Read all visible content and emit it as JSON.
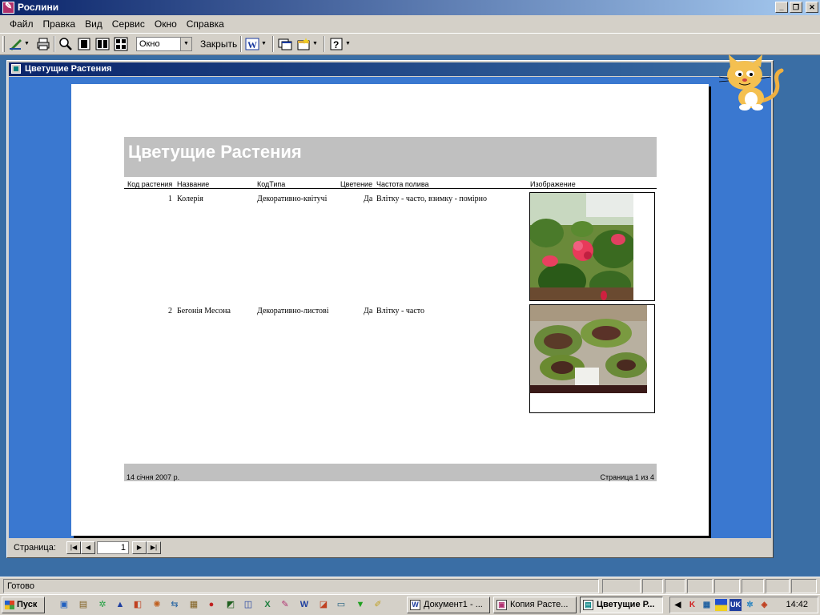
{
  "window": {
    "title": "Рослини"
  },
  "menu": [
    {
      "label": "Файл"
    },
    {
      "label": "Правка"
    },
    {
      "label": "Вид"
    },
    {
      "label": "Сервис"
    },
    {
      "label": "Окно"
    },
    {
      "label": "Справка"
    }
  ],
  "toolbar": {
    "zoom_value": "Окно",
    "close_label": "Закрыть"
  },
  "child": {
    "title": "Цветущие Растения"
  },
  "report": {
    "title": "Цветущие Растения",
    "columns": [
      "Код растения",
      "Название",
      "КодТипа",
      "Цветение",
      "Частота полива",
      "Изображение"
    ],
    "rows": [
      {
        "code": "1",
        "name": "Колерія",
        "type": "Декоративно-квітучі",
        "bloom": "Да",
        "water": "Влітку - часто, взимку - помірно"
      },
      {
        "code": "2",
        "name": "Бегонія Месона",
        "type": "Декоративно-листові",
        "bloom": "Да",
        "water": "Влітку - часто"
      }
    ],
    "footer_date": "14 січня 2007 р.",
    "footer_page": "Страница 1 из 4"
  },
  "navigator": {
    "label": "Страница:",
    "current_page": "1"
  },
  "status": {
    "text": "Готово"
  },
  "taskbar": {
    "start": "Пуск",
    "tasks": [
      {
        "label": "Документ1 - ..."
      },
      {
        "label": "Копия Расте..."
      },
      {
        "label": "Цветущие Р..."
      }
    ],
    "tray_lang": "UK",
    "clock": "14:42"
  }
}
